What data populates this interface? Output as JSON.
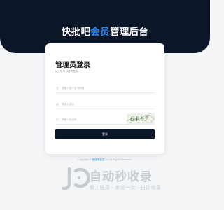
{
  "header": {
    "title_part1": "快批吧",
    "title_highlight": "会员",
    "title_part2": "管理后台"
  },
  "login": {
    "title": "管理员登录",
    "subtitle": "输入账号和密码登录",
    "username_placeholder": "请输入用户名或邮箱",
    "password_placeholder": "请输入密码",
    "captcha_placeholder": "请输入验证码",
    "captcha_text": "GPh7",
    "submit_label": "登录"
  },
  "footer": {
    "copyright_prefix": "Copyright ©",
    "copyright_link": "快批吧会员",
    "copyright_suffix": "Inc.All Rights Reserved."
  },
  "watermark": {
    "title": "自动秒收录",
    "tagline": "做上链接→来访一次→自动收录"
  },
  "colors": {
    "banner": "#0b1728",
    "accent": "#2d8cf0",
    "button": "#0b1728",
    "background": "#f3f5f7"
  },
  "icons": [
    "user-icon",
    "lock-icon",
    "shield-icon"
  ]
}
